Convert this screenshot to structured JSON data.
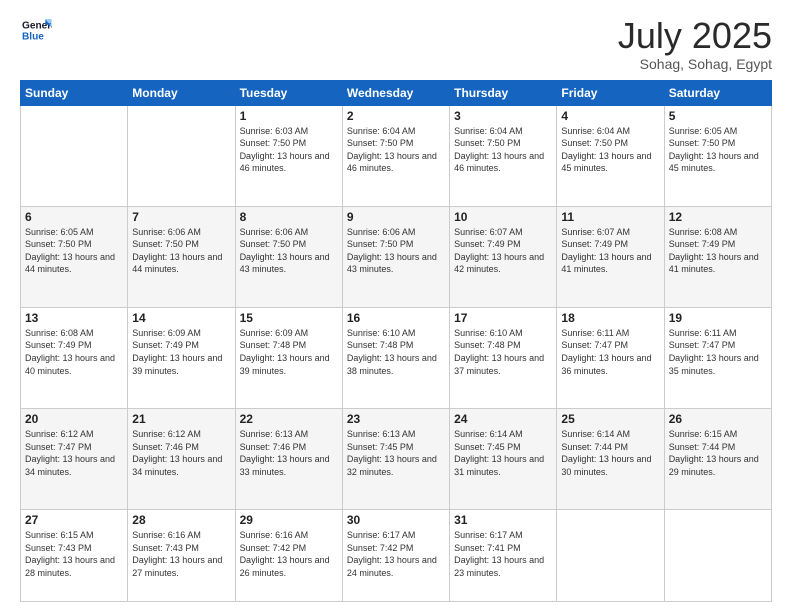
{
  "header": {
    "logo_text_general": "General",
    "logo_text_blue": "Blue",
    "month_year": "July 2025",
    "location": "Sohag, Sohag, Egypt"
  },
  "days_header": [
    "Sunday",
    "Monday",
    "Tuesday",
    "Wednesday",
    "Thursday",
    "Friday",
    "Saturday"
  ],
  "weeks": [
    {
      "days": [
        {
          "num": "",
          "info": ""
        },
        {
          "num": "",
          "info": ""
        },
        {
          "num": "1",
          "info": "Sunrise: 6:03 AM\nSunset: 7:50 PM\nDaylight: 13 hours and 46 minutes."
        },
        {
          "num": "2",
          "info": "Sunrise: 6:04 AM\nSunset: 7:50 PM\nDaylight: 13 hours and 46 minutes."
        },
        {
          "num": "3",
          "info": "Sunrise: 6:04 AM\nSunset: 7:50 PM\nDaylight: 13 hours and 46 minutes."
        },
        {
          "num": "4",
          "info": "Sunrise: 6:04 AM\nSunset: 7:50 PM\nDaylight: 13 hours and 45 minutes."
        },
        {
          "num": "5",
          "info": "Sunrise: 6:05 AM\nSunset: 7:50 PM\nDaylight: 13 hours and 45 minutes."
        }
      ]
    },
    {
      "days": [
        {
          "num": "6",
          "info": "Sunrise: 6:05 AM\nSunset: 7:50 PM\nDaylight: 13 hours and 44 minutes."
        },
        {
          "num": "7",
          "info": "Sunrise: 6:06 AM\nSunset: 7:50 PM\nDaylight: 13 hours and 44 minutes."
        },
        {
          "num": "8",
          "info": "Sunrise: 6:06 AM\nSunset: 7:50 PM\nDaylight: 13 hours and 43 minutes."
        },
        {
          "num": "9",
          "info": "Sunrise: 6:06 AM\nSunset: 7:50 PM\nDaylight: 13 hours and 43 minutes."
        },
        {
          "num": "10",
          "info": "Sunrise: 6:07 AM\nSunset: 7:49 PM\nDaylight: 13 hours and 42 minutes."
        },
        {
          "num": "11",
          "info": "Sunrise: 6:07 AM\nSunset: 7:49 PM\nDaylight: 13 hours and 41 minutes."
        },
        {
          "num": "12",
          "info": "Sunrise: 6:08 AM\nSunset: 7:49 PM\nDaylight: 13 hours and 41 minutes."
        }
      ]
    },
    {
      "days": [
        {
          "num": "13",
          "info": "Sunrise: 6:08 AM\nSunset: 7:49 PM\nDaylight: 13 hours and 40 minutes."
        },
        {
          "num": "14",
          "info": "Sunrise: 6:09 AM\nSunset: 7:49 PM\nDaylight: 13 hours and 39 minutes."
        },
        {
          "num": "15",
          "info": "Sunrise: 6:09 AM\nSunset: 7:48 PM\nDaylight: 13 hours and 39 minutes."
        },
        {
          "num": "16",
          "info": "Sunrise: 6:10 AM\nSunset: 7:48 PM\nDaylight: 13 hours and 38 minutes."
        },
        {
          "num": "17",
          "info": "Sunrise: 6:10 AM\nSunset: 7:48 PM\nDaylight: 13 hours and 37 minutes."
        },
        {
          "num": "18",
          "info": "Sunrise: 6:11 AM\nSunset: 7:47 PM\nDaylight: 13 hours and 36 minutes."
        },
        {
          "num": "19",
          "info": "Sunrise: 6:11 AM\nSunset: 7:47 PM\nDaylight: 13 hours and 35 minutes."
        }
      ]
    },
    {
      "days": [
        {
          "num": "20",
          "info": "Sunrise: 6:12 AM\nSunset: 7:47 PM\nDaylight: 13 hours and 34 minutes."
        },
        {
          "num": "21",
          "info": "Sunrise: 6:12 AM\nSunset: 7:46 PM\nDaylight: 13 hours and 34 minutes."
        },
        {
          "num": "22",
          "info": "Sunrise: 6:13 AM\nSunset: 7:46 PM\nDaylight: 13 hours and 33 minutes."
        },
        {
          "num": "23",
          "info": "Sunrise: 6:13 AM\nSunset: 7:45 PM\nDaylight: 13 hours and 32 minutes."
        },
        {
          "num": "24",
          "info": "Sunrise: 6:14 AM\nSunset: 7:45 PM\nDaylight: 13 hours and 31 minutes."
        },
        {
          "num": "25",
          "info": "Sunrise: 6:14 AM\nSunset: 7:44 PM\nDaylight: 13 hours and 30 minutes."
        },
        {
          "num": "26",
          "info": "Sunrise: 6:15 AM\nSunset: 7:44 PM\nDaylight: 13 hours and 29 minutes."
        }
      ]
    },
    {
      "days": [
        {
          "num": "27",
          "info": "Sunrise: 6:15 AM\nSunset: 7:43 PM\nDaylight: 13 hours and 28 minutes."
        },
        {
          "num": "28",
          "info": "Sunrise: 6:16 AM\nSunset: 7:43 PM\nDaylight: 13 hours and 27 minutes."
        },
        {
          "num": "29",
          "info": "Sunrise: 6:16 AM\nSunset: 7:42 PM\nDaylight: 13 hours and 26 minutes."
        },
        {
          "num": "30",
          "info": "Sunrise: 6:17 AM\nSunset: 7:42 PM\nDaylight: 13 hours and 24 minutes."
        },
        {
          "num": "31",
          "info": "Sunrise: 6:17 AM\nSunset: 7:41 PM\nDaylight: 13 hours and 23 minutes."
        },
        {
          "num": "",
          "info": ""
        },
        {
          "num": "",
          "info": ""
        }
      ]
    }
  ]
}
